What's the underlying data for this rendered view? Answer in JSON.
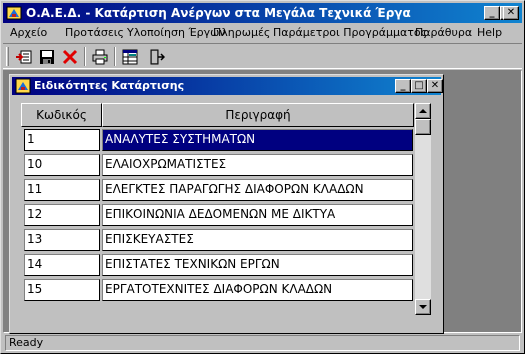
{
  "window": {
    "title": "Ο.Α.Ε.Δ. - Κατάρτιση Ανέργων στα Μεγάλα Τεχνικά Έργα"
  },
  "menu": [
    "Αρχείο",
    "Προτάσεις",
    "Υλοποίηση Έργων",
    "Πληρωμές",
    "Παράμετροι Προγράμματος",
    "Παράθυρα",
    "Help"
  ],
  "toolbar": {
    "icons": [
      "insert-record-icon",
      "save-icon",
      "delete-icon",
      "print-icon",
      "grid-view-icon",
      "exit-icon"
    ]
  },
  "child": {
    "title": "Ειδικότητες Κατάρτισης"
  },
  "grid": {
    "columns": [
      "Κωδικός",
      "Περιγραφή"
    ],
    "rows": [
      {
        "code": "1",
        "desc": "ΑΝΑΛΥΤΕΣ ΣΥΣΤΗΜΑΤΩΝ"
      },
      {
        "code": "10",
        "desc": "ΕΛΑΙΟΧΡΩΜΑΤΙΣΤΕΣ"
      },
      {
        "code": "11",
        "desc": "ΕΛΕΓΚΤΕΣ ΠΑΡΑΓΩΓΗΣ ΔΙΑΦΟΡΩΝ ΚΛΑΔΩΝ"
      },
      {
        "code": "12",
        "desc": "ΕΠΙΚΟΙΝΩΝΙΑ ΔΕΔΟΜΕΝΩΝ ΜΕ ΔΙΚΤΥΑ"
      },
      {
        "code": "13",
        "desc": "ΕΠΙΣΚΕΥΑΣΤΕΣ"
      },
      {
        "code": "14",
        "desc": "ΕΠΙΣΤΑΤΕΣ ΤΕΧΝΙΚΩΝ ΕΡΓΩΝ"
      },
      {
        "code": "15",
        "desc": "ΕΡΓΑΤΟΤΕΧΝΙΤΕΣ ΔΙΑΦΟΡΩΝ ΚΛΑΔΩΝ"
      }
    ]
  },
  "status": {
    "text": "Ready"
  }
}
